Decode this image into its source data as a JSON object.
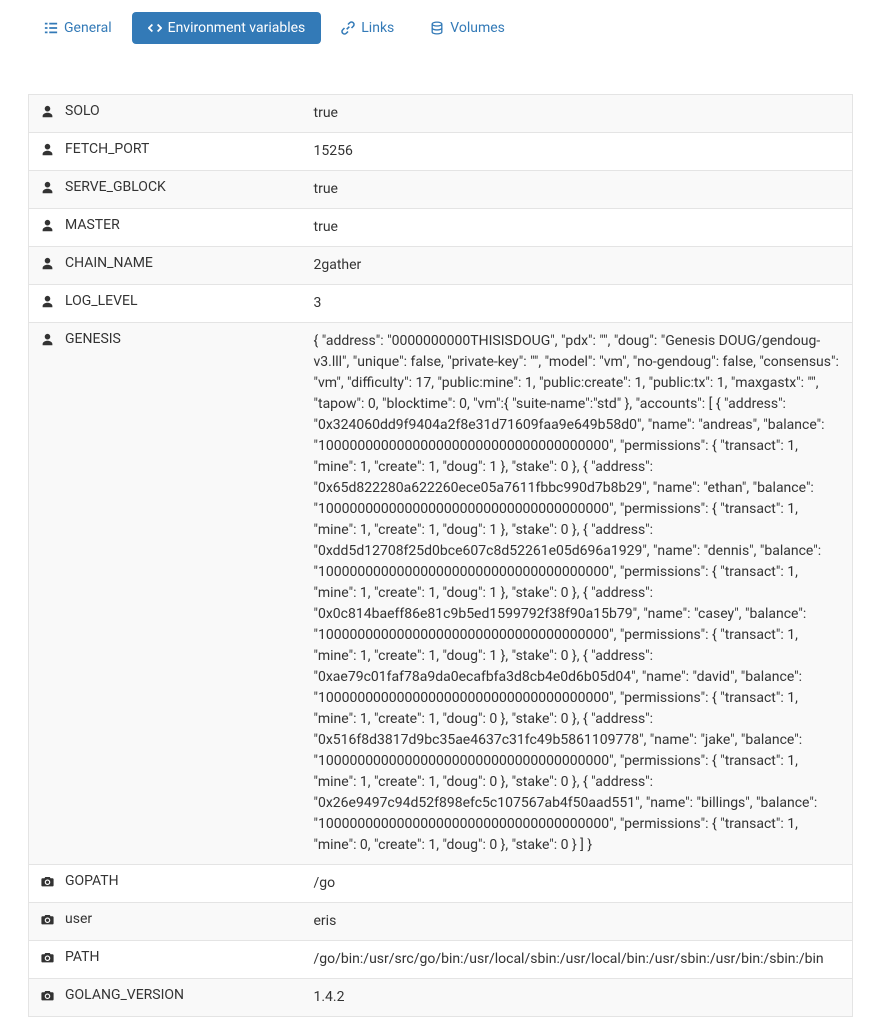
{
  "tabs": {
    "general": "General",
    "env": "Environment variables",
    "links": "Links",
    "volumes": "Volumes"
  },
  "rows": [
    {
      "icon": "user",
      "key": "SOLO",
      "value": "true"
    },
    {
      "icon": "user",
      "key": "FETCH_PORT",
      "value": "15256"
    },
    {
      "icon": "user",
      "key": "SERVE_GBLOCK",
      "value": "true"
    },
    {
      "icon": "user",
      "key": "MASTER",
      "value": "true"
    },
    {
      "icon": "user",
      "key": "CHAIN_NAME",
      "value": "2gather"
    },
    {
      "icon": "user",
      "key": "LOG_LEVEL",
      "value": "3"
    },
    {
      "icon": "user",
      "key": "GENESIS",
      "value": "{ \"address\": \"0000000000THISISDOUG\", \"pdx\": \"\", \"doug\": \"Genesis DOUG/gendoug-v3.lll\", \"unique\": false, \"private-key\": \"\", \"model\": \"vm\", \"no-gendoug\": false, \"consensus\": \"vm\", \"difficulty\": 17, \"public:mine\": 1, \"public:create\": 1, \"public:tx\": 1, \"maxgastx\": \"\", \"tapow\": 0, \"blocktime\": 0, \"vm\":{ \"suite-name\":\"std\" }, \"accounts\": [ { \"address\": \"0x324060dd9f9404a2f8e31d71609faa9e649b58d0\", \"name\": \"andreas\", \"balance\": \"1000000000000000000000000000000000000\", \"permissions\": { \"transact\": 1, \"mine\": 1, \"create\": 1, \"doug\": 1 }, \"stake\": 0 }, { \"address\": \"0x65d822280a622260ece05a7611fbbc990d7b8b29\", \"name\": \"ethan\", \"balance\": \"1000000000000000000000000000000000000\", \"permissions\": { \"transact\": 1, \"mine\": 1, \"create\": 1, \"doug\": 1 }, \"stake\": 0 }, { \"address\": \"0xdd5d12708f25d0bce607c8d52261e05d696a1929\", \"name\": \"dennis\", \"balance\": \"1000000000000000000000000000000000000\", \"permissions\": { \"transact\": 1, \"mine\": 1, \"create\": 1, \"doug\": 1 }, \"stake\": 0 }, { \"address\": \"0x0c814baeff86e81c9b5ed1599792f38f90a15b79\", \"name\": \"casey\", \"balance\": \"1000000000000000000000000000000000000\", \"permissions\": { \"transact\": 1, \"mine\": 1, \"create\": 1, \"doug\": 1 }, \"stake\": 0 }, { \"address\": \"0xae79c01faf78a9da0ecafbfa3d8cb4e0d6b05d04\", \"name\": \"david\", \"balance\": \"1000000000000000000000000000000000000\", \"permissions\": { \"transact\": 1, \"mine\": 1, \"create\": 1, \"doug\": 0 }, \"stake\": 0 }, { \"address\": \"0x516f8d3817d9bc35ae4637c31fc49b5861109778\", \"name\": \"jake\", \"balance\": \"1000000000000000000000000000000000000\", \"permissions\": { \"transact\": 1, \"mine\": 1, \"create\": 1, \"doug\": 0 }, \"stake\": 0 }, { \"address\": \"0x26e9497c94d52f898efc5c107567ab4f50aad551\", \"name\": \"billings\", \"balance\": \"1000000000000000000000000000000000000\", \"permissions\": { \"transact\": 1, \"mine\": 0, \"create\": 1, \"doug\": 0 }, \"stake\": 0 } ] }"
    },
    {
      "icon": "camera",
      "key": "GOPATH",
      "value": "/go"
    },
    {
      "icon": "camera",
      "key": "user",
      "value": "eris"
    },
    {
      "icon": "camera",
      "key": "PATH",
      "value": "/go/bin:/usr/src/go/bin:/usr/local/sbin:/usr/local/bin:/usr/sbin:/usr/bin:/sbin:/bin"
    },
    {
      "icon": "camera",
      "key": "GOLANG_VERSION",
      "value": "1.4.2"
    }
  ]
}
